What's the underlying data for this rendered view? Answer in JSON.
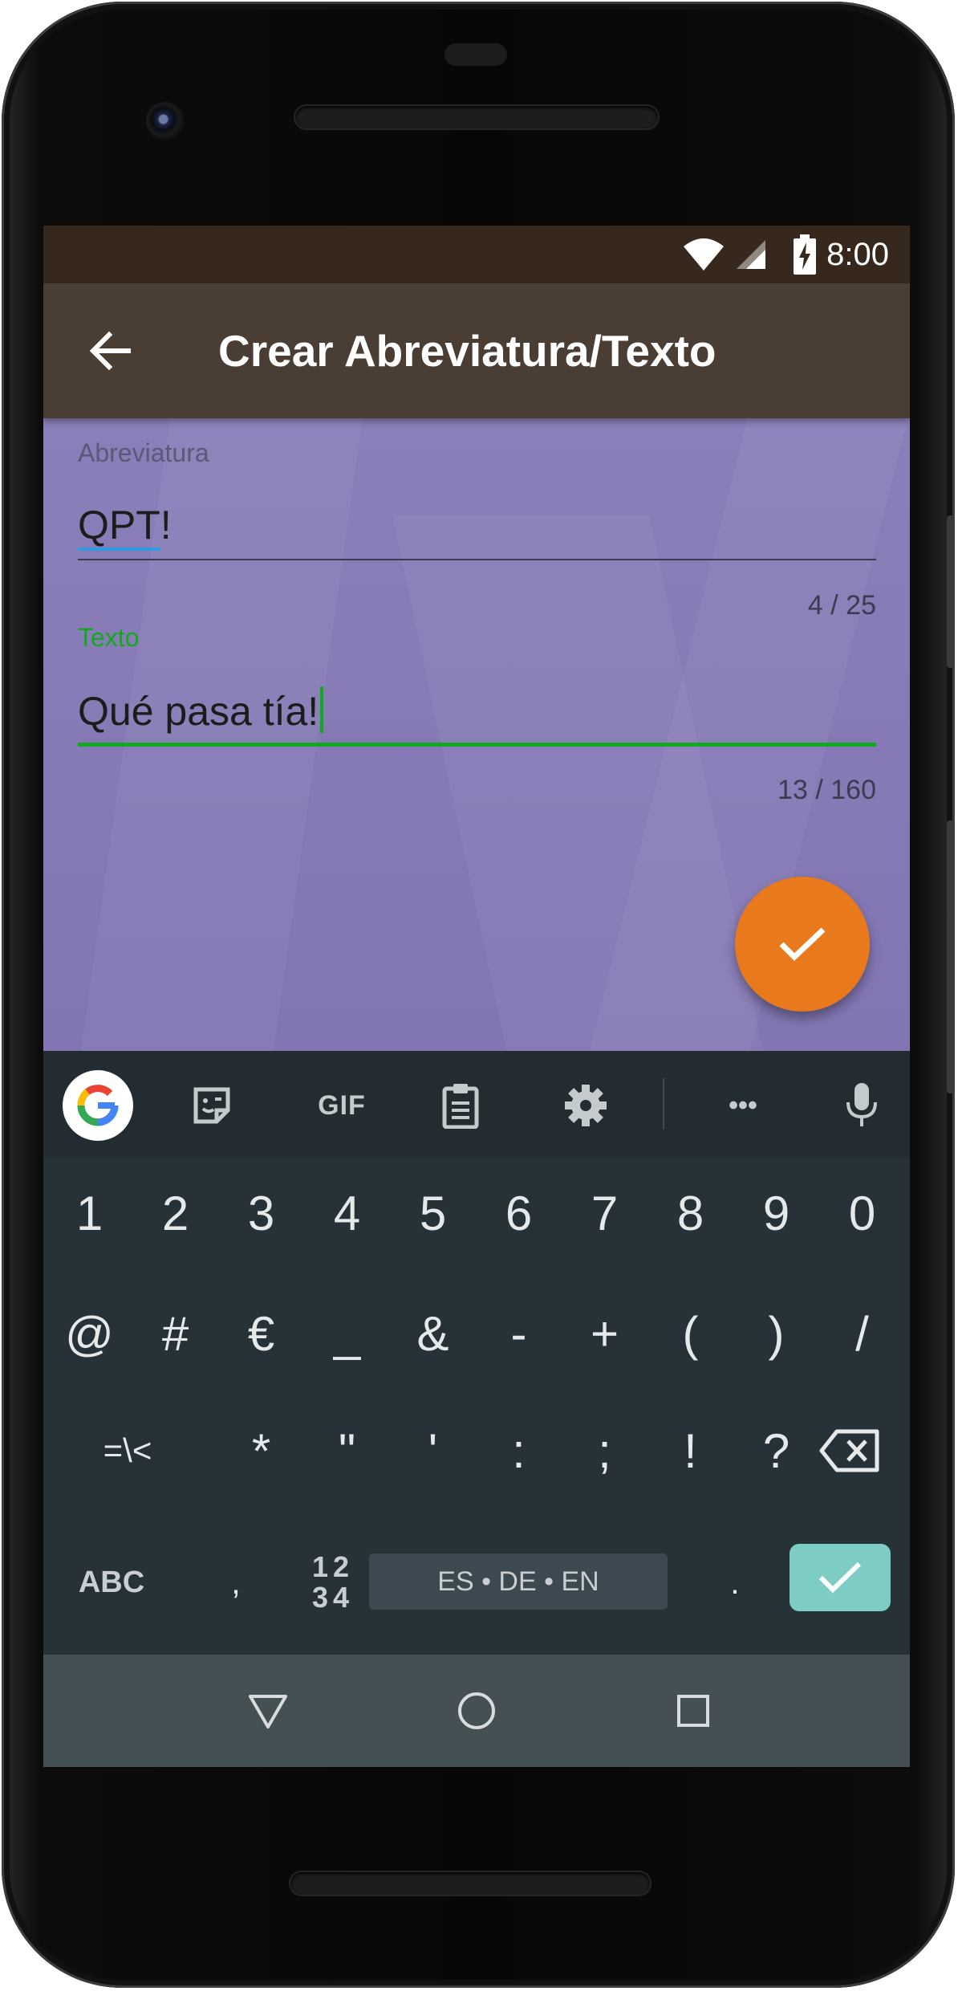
{
  "status_bar": {
    "time": "8:00"
  },
  "app_bar": {
    "title": "Crear Abreviatura/Texto"
  },
  "form": {
    "abbreviation": {
      "label": "Abreviatura",
      "value_prefix": "QPT",
      "value_suffix": "!",
      "counter": "4 / 25"
    },
    "text": {
      "label": "Texto",
      "value": "Qué pasa tía!",
      "counter": "13 / 160"
    }
  },
  "keyboard": {
    "toolbar": {
      "gif_label": "GIF",
      "more_label": "•••"
    },
    "row1": [
      "1",
      "2",
      "3",
      "4",
      "5",
      "6",
      "7",
      "8",
      "9",
      "0"
    ],
    "row2": [
      "@",
      "#",
      "€",
      "_",
      "&",
      "-",
      "+",
      "(",
      ")",
      "/"
    ],
    "row3": [
      "=\\<",
      "*",
      "\"",
      "'",
      ":",
      ";",
      "!",
      "?"
    ],
    "row4": {
      "abc_label": "ABC",
      "comma": ",",
      "numpad_top": "12",
      "numpad_bottom": "34",
      "space_label": "ES • DE • EN",
      "period": "."
    }
  },
  "colors": {
    "status_bar": "#36281c",
    "app_bar": "#4a3d33",
    "content_bg": "#8a7fb8",
    "accent_green": "#14a81e",
    "fab": "#e8791c",
    "keyboard_bg": "#263238",
    "enter_key": "#7ecdc4"
  },
  "icons": {
    "back": "arrow-left-icon",
    "fab": "check-icon",
    "toolbar": [
      "google-icon",
      "sticker-icon",
      "gif-icon",
      "clipboard-icon",
      "settings-icon",
      "more-icon",
      "microphone-icon"
    ],
    "nav": [
      "back-triangle-icon",
      "home-circle-icon",
      "recents-square-icon"
    ]
  }
}
